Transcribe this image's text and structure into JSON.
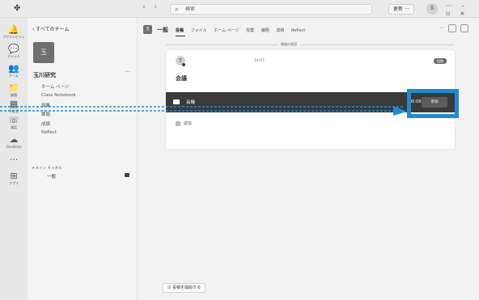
{
  "titlebar": {
    "nav_back": "‹",
    "nav_forward": "›",
    "search_placeholder": "検索",
    "update_label": "更新 ···",
    "avatar_text": "玉",
    "window_controls": [
      "···",
      "–",
      "▫",
      "×"
    ]
  },
  "appbar": {
    "items": [
      {
        "label": "アクティビティ",
        "glyph": "🔔"
      },
      {
        "label": "チャット",
        "glyph": "💬"
      },
      {
        "label": "チーム",
        "glyph": "👥"
      },
      {
        "label": "課題",
        "glyph": "📁"
      },
      {
        "label": "予定表",
        "glyph": "▦"
      },
      {
        "label": "通話",
        "glyph": "☏"
      },
      {
        "label": "OneDrive",
        "glyph": "☁"
      },
      {
        "label": "",
        "glyph": "···"
      },
      {
        "label": "アプリ",
        "glyph": "⊞"
      }
    ]
  },
  "teampanel": {
    "back_label": "‹  すべてのチーム",
    "tile_text": "玉",
    "team_name": "玉川研究",
    "more": "···",
    "menu": [
      "ホーム ページ",
      "Class Notebook",
      "授業",
      "課題",
      "成績",
      "Reflect"
    ],
    "channels_head": "▾ メイン チャネル",
    "channel_general": "一般"
  },
  "main": {
    "chan_icon_text": "玉",
    "channel_name": "一般",
    "tabs": [
      "投稿",
      "ファイル",
      "ホーム ページ",
      "授業",
      "課題",
      "成績",
      "Reflect"
    ],
    "header_right": "···",
    "divider_label": "最後の既読",
    "post": {
      "avatar_text": "玉",
      "time": "14:07",
      "badge": "投稿",
      "title": "会議",
      "meeting_title": "会議",
      "meeting_time": "00:09",
      "join_label": "参加",
      "reply_label": "返信"
    },
    "compose_label": "☑  投稿を開始する"
  },
  "colors": {
    "highlight": "#1f8ccf"
  }
}
